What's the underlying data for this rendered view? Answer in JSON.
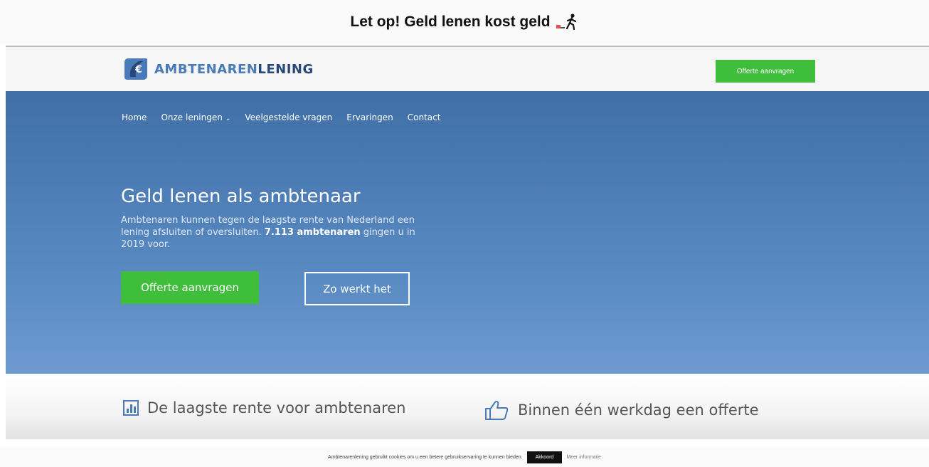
{
  "warning": {
    "text": "Let op! Geld lenen kost geld"
  },
  "header": {
    "logo_part1": "AMBTENAREN",
    "logo_part2": "LENING",
    "cta_label": "Offerte aanvragen"
  },
  "nav": {
    "items": [
      "Home",
      "Onze leningen",
      "Veelgestelde vragen",
      "Ervaringen",
      "Contact"
    ],
    "dropdown_indicator": "⌄"
  },
  "hero": {
    "title": "Geld lenen als ambtenaar",
    "subtitle_part1": "Ambtenaren kunnen tegen de laagste rente van Nederland een lening afsluiten of oversluiten. ",
    "subtitle_bold": "7.113 ambtenaren",
    "subtitle_part2": " gingen u in 2019 voor.",
    "primary_button": "Offerte aanvragen",
    "secondary_button": "Zo werkt het"
  },
  "features": {
    "item1": "De laagste rente voor ambtenaren",
    "item2": "Binnen één werkdag een offerte"
  },
  "cookie": {
    "text": "Ambtenarenlening gebruikt cookies om u een betere gebruikservaring te kunnen bieden.",
    "accept_label": "Akkoord",
    "more_label": "Meer informatie"
  },
  "colors": {
    "brand_blue": "#4a7ab8",
    "brand_dark": "#28487a",
    "accent_green": "#3fbe3b"
  },
  "icons": [
    "walker-icon",
    "logo-icon",
    "bar-chart-icon",
    "thumbs-up-icon"
  ]
}
